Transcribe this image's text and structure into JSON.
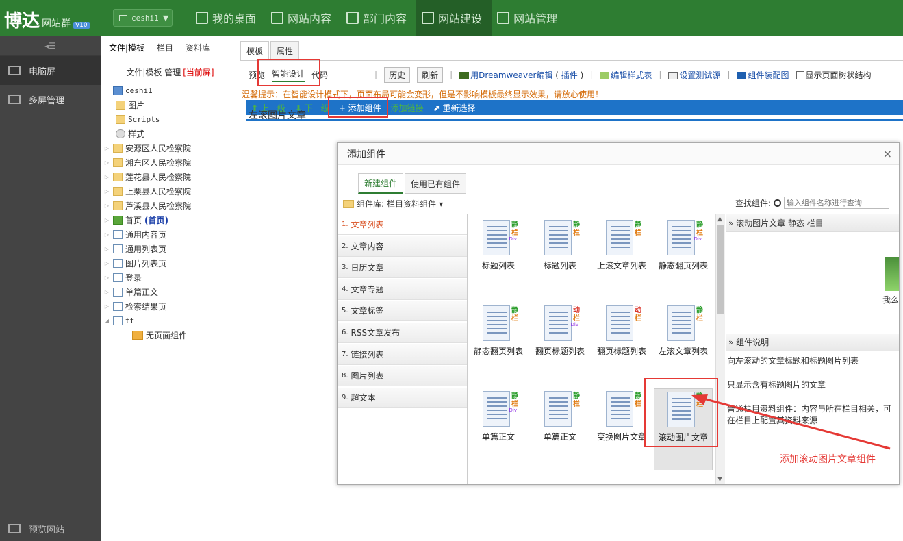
{
  "topbar": {
    "logo_main": "博达",
    "logo_sub": "网站群",
    "logo_ver": "V10",
    "site_select": "ceshi1",
    "nav": [
      "我的桌面",
      "网站内容",
      "部门内容",
      "网站建设",
      "网站管理"
    ],
    "active_nav": "网站建设"
  },
  "leftbar": {
    "items": [
      "电脑屏",
      "多屏管理"
    ],
    "bottom": "预览网站"
  },
  "treepanel": {
    "tabs": [
      "文件|模板",
      "栏目",
      "资料库"
    ],
    "sub_label": "文件|模板 管理",
    "sub_current": "[当前屏]",
    "tree": [
      {
        "label": "ceshi1",
        "icon": "monitor",
        "arrow": "",
        "indent": 0
      },
      {
        "label": "图片",
        "icon": "folder",
        "arrow": "",
        "indent": 1
      },
      {
        "label": "Scripts",
        "icon": "folder",
        "arrow": "",
        "indent": 1
      },
      {
        "label": "样式",
        "icon": "gear",
        "arrow": "",
        "indent": 1
      },
      {
        "label": "安源区人民检察院",
        "icon": "folder",
        "arrow": "▷",
        "indent": 1
      },
      {
        "label": "湘东区人民检察院",
        "icon": "folder",
        "arrow": "▷",
        "indent": 1
      },
      {
        "label": "莲花县人民检察院",
        "icon": "folder",
        "arrow": "▷",
        "indent": 1
      },
      {
        "label": "上栗县人民检察院",
        "icon": "folder",
        "arrow": "▷",
        "indent": 1
      },
      {
        "label": "芦溪县人民检察院",
        "icon": "folder",
        "arrow": "▷",
        "indent": 1
      },
      {
        "label": "首页",
        "icon": "home",
        "arrow": "▷",
        "indent": 1,
        "tag": "(首页)"
      },
      {
        "label": "通用内容页",
        "icon": "page",
        "arrow": "▷",
        "indent": 1
      },
      {
        "label": "通用列表页",
        "icon": "page",
        "arrow": "▷",
        "indent": 1
      },
      {
        "label": "图片列表页",
        "icon": "page",
        "arrow": "▷",
        "indent": 1
      },
      {
        "label": "登录",
        "icon": "page",
        "arrow": "▷",
        "indent": 1
      },
      {
        "label": "单篇正文",
        "icon": "page",
        "arrow": "▷",
        "indent": 1
      },
      {
        "label": "检索结果页",
        "icon": "page",
        "arrow": "▷",
        "indent": 1
      },
      {
        "label": "tt",
        "icon": "page",
        "arrow": "◢",
        "indent": 1
      },
      {
        "label": "无页面组件",
        "icon": "txt",
        "arrow": "",
        "indent": 2
      }
    ]
  },
  "main": {
    "tabs": [
      "模板",
      "属性"
    ],
    "toolbar": {
      "preview": "预览",
      "smart": "智能设计",
      "code": "代码",
      "history": "历史",
      "refresh": "刷新",
      "dw_prefix": "用Dreamweaver编辑",
      "plugin": "插件",
      "edit_style": "编辑样式表",
      "test_source": "设置测试源",
      "component_map": "组件装配图",
      "show_tree": "显示页面树状结构"
    },
    "tip": "温馨提示：在智能设计模式下，页面布局可能会变形，但是不影响模板最终显示效果，请放心使用！",
    "bluebar": {
      "up": "上一级",
      "down": "下一级",
      "add": "+ 添加组件",
      "add_link": "添加链接",
      "reselect": "重新选择"
    },
    "under_text": "左滚图片文章"
  },
  "dialog": {
    "title": "添加组件",
    "tabs": [
      "新建组件",
      "使用已有组件"
    ],
    "lib_label": "组件库:",
    "lib_value": "栏目资料组件",
    "search_label": "查找组件:",
    "search_placeholder": "输入组件名称进行查询",
    "categories": [
      {
        "num": "1.",
        "label": "文章列表"
      },
      {
        "num": "2.",
        "label": "文章内容"
      },
      {
        "num": "3.",
        "label": "日历文章"
      },
      {
        "num": "4.",
        "label": "文章专题"
      },
      {
        "num": "5.",
        "label": "文章标签"
      },
      {
        "num": "6.",
        "label": "RSS文章发布"
      },
      {
        "num": "7.",
        "label": "链接列表"
      },
      {
        "num": "8.",
        "label": "图片列表"
      },
      {
        "num": "9.",
        "label": "超文本"
      }
    ],
    "components": [
      {
        "label": "标题列表",
        "b1": "静",
        "b2": "栏",
        "b3": "Div"
      },
      {
        "label": "标题列表",
        "b1": "静",
        "b2": "栏",
        "b3": ""
      },
      {
        "label": "上滚文章列表",
        "b1": "静",
        "b2": "栏",
        "b3": ""
      },
      {
        "label": "静态翻页列表",
        "b1": "静",
        "b2": "栏",
        "b3": "Div"
      },
      {
        "label": "静态翻页列表",
        "b1": "静",
        "b2": "栏",
        "b3": ""
      },
      {
        "label": "翻页标题列表",
        "b1": "动",
        "b2": "栏",
        "b3": "Div"
      },
      {
        "label": "翻页标题列表",
        "b1": "动",
        "b2": "栏",
        "b3": ""
      },
      {
        "label": "左滚文章列表",
        "b1": "静",
        "b2": "栏",
        "b3": ""
      },
      {
        "label": "单篇正文",
        "b1": "静",
        "b2": "栏",
        "b3": "Div"
      },
      {
        "label": "单篇正文",
        "b1": "静",
        "b2": "栏",
        "b3": ""
      },
      {
        "label": "变换图片文章",
        "b1": "静",
        "b2": "栏",
        "b3": ""
      },
      {
        "label": "滚动图片文章",
        "b1": "静",
        "b2": "栏",
        "b3": ""
      }
    ],
    "selected_component": "滚动图片文章",
    "preview_head": "» 滚动图片文章 静态 栏目",
    "preview_caption": "我么",
    "desc_head": "» 组件说明",
    "desc": [
      "向左滚动的文章标题和标题图片列表",
      "只显示含有标题图片的文章",
      "普通栏目资料组件：内容与所在栏目相关，可在栏目上配置其资料来源"
    ]
  },
  "annotation": "添加滚动图片文章组件",
  "colors": {
    "brand_green": "#2e7d32",
    "highlight_red": "#e53935",
    "bar_blue": "#1e73c8"
  }
}
